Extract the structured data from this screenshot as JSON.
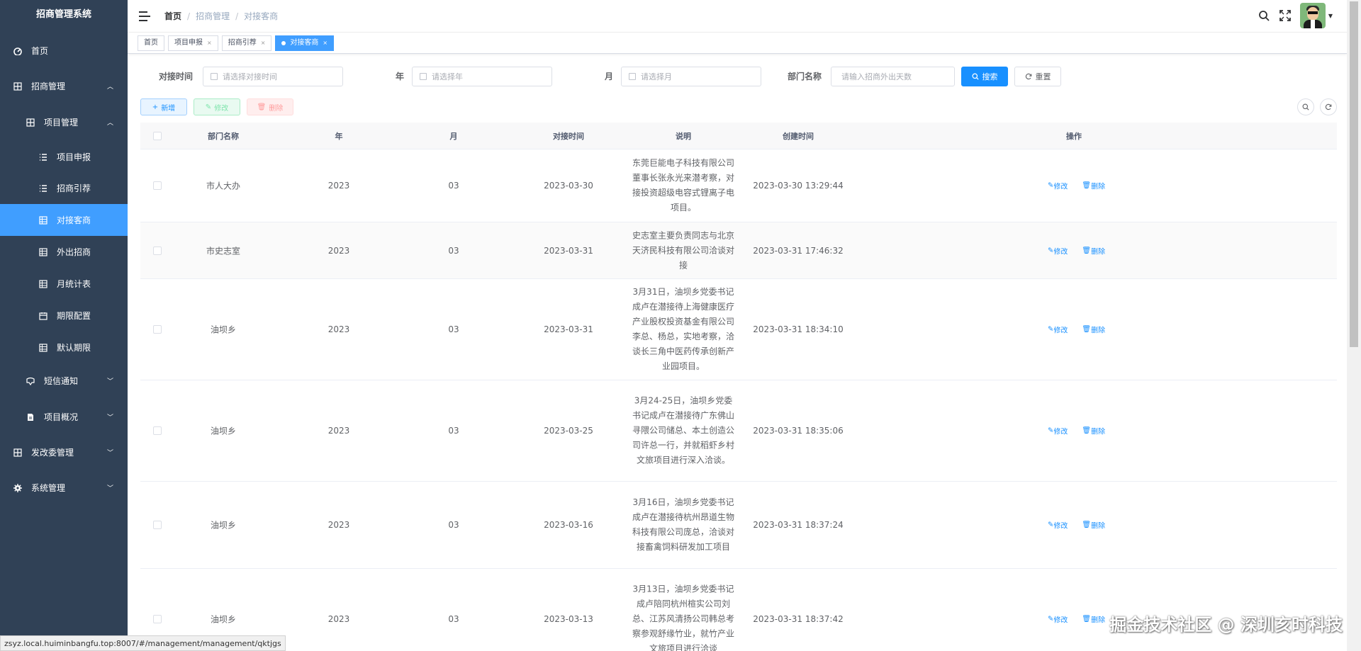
{
  "app": {
    "title": "招商管理系统"
  },
  "sidebar": {
    "items": [
      {
        "label": "首页",
        "icon": "dashboard-icon"
      },
      {
        "label": "招商管理",
        "icon": "grid-icon"
      },
      {
        "label": "项目管理",
        "icon": "grid-icon"
      },
      {
        "label": "项目申报",
        "icon": "list-icon"
      },
      {
        "label": "招商引荐",
        "icon": "list-icon"
      },
      {
        "label": "对接客商",
        "icon": "table-icon"
      },
      {
        "label": "外出招商",
        "icon": "table-icon"
      },
      {
        "label": "月统计表",
        "icon": "table-icon"
      },
      {
        "label": "期限配置",
        "icon": "calendar-icon"
      },
      {
        "label": "默认期限",
        "icon": "table-icon"
      },
      {
        "label": "短信通知",
        "icon": "message-icon"
      },
      {
        "label": "项目概况",
        "icon": "document-icon"
      },
      {
        "label": "发改委管理",
        "icon": "grid-icon"
      },
      {
        "label": "系统管理",
        "icon": "gear-icon"
      }
    ]
  },
  "breadcrumb": [
    "首页",
    "招商管理",
    "对接客商"
  ],
  "tags": [
    "首页",
    "项目申报",
    "招商引荐",
    "对接客商"
  ],
  "search": {
    "label_time": "对接时间",
    "placeholder_time": "请选择对接时间",
    "label_year": "年",
    "placeholder_year": "请选择年",
    "label_month": "月",
    "placeholder_month": "请选择月",
    "label_dept": "部门名称",
    "placeholder_dept": "请输入招商外出天数",
    "search_btn": "搜索",
    "reset_btn": "重置"
  },
  "toolbar": {
    "add": "新增",
    "edit": "修改",
    "delete": "删除"
  },
  "table": {
    "headers": [
      "部门名称",
      "年",
      "月",
      "对接时间",
      "说明",
      "创建时间",
      "操作"
    ],
    "rows": [
      {
        "dept": "市人大办",
        "year": "2023",
        "month": "03",
        "date": "2023-03-30",
        "desc": "东莞巨能电子科技有限公司董事长张永光来潜考察，对接投资超级电容式锂离子电项目。",
        "created": "2023-03-30 13:29:44"
      },
      {
        "dept": "市史志室",
        "year": "2023",
        "month": "03",
        "date": "2023-03-31",
        "desc": "史志室主要负责同志与北京天济民科技有限公司洽谈对接",
        "created": "2023-03-31 17:46:32"
      },
      {
        "dept": "油坝乡",
        "year": "2023",
        "month": "03",
        "date": "2023-03-31",
        "desc": "3月31日，油坝乡党委书记成卢在潜接待上海健康医疗产业股权投资基金有限公司李总、杨总，实地考察，洽谈长三角中医药传承创新产业园项目。",
        "created": "2023-03-31 18:34:10"
      },
      {
        "dept": "油坝乡",
        "year": "2023",
        "month": "03",
        "date": "2023-03-25",
        "desc": "3月24-25日，油坝乡党委书记成卢在潜接待广东佛山寻隈公司储总、本土创造公司许总一行，并就稻虾乡村文旅项目进行深入洽谈。",
        "created": "2023-03-31 18:35:06"
      },
      {
        "dept": "油坝乡",
        "year": "2023",
        "month": "03",
        "date": "2023-03-16",
        "desc": "3月16日，油坝乡党委书记成卢在潜接待杭州昂道生物科技有限公司庞总，洽谈对接畜禽饲料研发加工项目",
        "created": "2023-03-31 18:37:24"
      },
      {
        "dept": "油坝乡",
        "year": "2023",
        "month": "03",
        "date": "2023-03-13",
        "desc": "3月13日，油坝乡党委书记成卢陪同杭州楦实公司刘总、江苏风清扬公司韩总考察参观舒缘竹业，就竹产业文旅项目进行洽谈",
        "created": "2023-03-31 18:37:42"
      }
    ],
    "op_edit": "修改",
    "op_delete": "删除"
  },
  "status_url": "zsyz.local.huiminbangfu.top:8007/#/management/management/qktjgs",
  "watermark": "掘金技术社区 @ 深圳亥时科技"
}
